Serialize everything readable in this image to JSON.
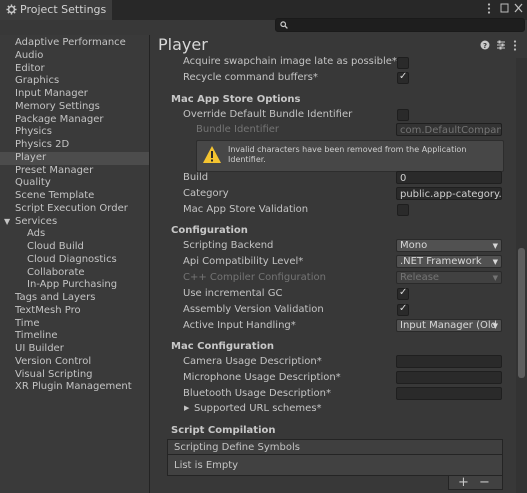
{
  "window": {
    "title": "Project Settings"
  },
  "search": {
    "placeholder": ""
  },
  "sidebar": {
    "items": [
      {
        "label": "Adaptive Performance"
      },
      {
        "label": "Audio"
      },
      {
        "label": "Editor"
      },
      {
        "label": "Graphics"
      },
      {
        "label": "Input Manager"
      },
      {
        "label": "Memory Settings"
      },
      {
        "label": "Package Manager"
      },
      {
        "label": "Physics"
      },
      {
        "label": "Physics 2D"
      },
      {
        "label": "Player",
        "selected": true
      },
      {
        "label": "Preset Manager"
      },
      {
        "label": "Quality"
      },
      {
        "label": "Scene Template"
      },
      {
        "label": "Script Execution Order"
      },
      {
        "label": "Services",
        "expanded": true
      },
      {
        "label": "Ads"
      },
      {
        "label": "Cloud Build"
      },
      {
        "label": "Cloud Diagnostics"
      },
      {
        "label": "Collaborate"
      },
      {
        "label": "In-App Purchasing"
      },
      {
        "label": "Tags and Layers"
      },
      {
        "label": "TextMesh Pro"
      },
      {
        "label": "Time"
      },
      {
        "label": "Timeline"
      },
      {
        "label": "UI Builder"
      },
      {
        "label": "Version Control"
      },
      {
        "label": "Visual Scripting"
      },
      {
        "label": "XR Plugin Management"
      }
    ]
  },
  "panel": {
    "title": "Player"
  },
  "settings": {
    "acquire_swapchain": {
      "label": "Acquire swapchain image late as possible*",
      "checked": false
    },
    "recycle_buffers": {
      "label": "Recycle command buffers*",
      "checked": true
    },
    "mac_app_store": {
      "header": "Mac App Store Options",
      "override_bundle": {
        "label": "Override Default Bundle Identifier",
        "checked": false
      },
      "bundle_identifier": {
        "label": "Bundle Identifier",
        "value": "com.DefaultCompany"
      },
      "warning": "Invalid characters have been removed from the Application Identifier.",
      "build": {
        "label": "Build",
        "value": "0"
      },
      "category": {
        "label": "Category",
        "value": "public.app-category.g"
      },
      "validation": {
        "label": "Mac App Store Validation",
        "checked": false
      }
    },
    "configuration": {
      "header": "Configuration",
      "scripting_backend": {
        "label": "Scripting Backend",
        "value": "Mono"
      },
      "api_compat": {
        "label": "Api Compatibility Level*",
        "value": ".NET Framework"
      },
      "cpp_compiler": {
        "label": "C++ Compiler Configuration",
        "value": "Release"
      },
      "incremental_gc": {
        "label": "Use incremental GC",
        "checked": true
      },
      "assembly_validation": {
        "label": "Assembly Version Validation",
        "checked": true
      },
      "input_handling": {
        "label": "Active Input Handling*",
        "value": "Input Manager (Old"
      }
    },
    "mac_configuration": {
      "header": "Mac Configuration",
      "camera_usage": {
        "label": "Camera Usage Description*",
        "value": ""
      },
      "microphone_usage": {
        "label": "Microphone Usage Description*",
        "value": ""
      },
      "bluetooth_usage": {
        "label": "Bluetooth Usage Description*",
        "value": ""
      },
      "url_schemes": {
        "label": "Supported URL schemes*"
      }
    },
    "script_compilation": {
      "header": "Script Compilation",
      "define_symbols": {
        "label": "Scripting Define Symbols",
        "empty_text": "List is Empty"
      },
      "add_button": "+",
      "remove_button": "−"
    }
  },
  "icons": {
    "window": "gear-icon",
    "help": "question-icon",
    "presets": "sliders-icon",
    "more": "kebab-menu-icon",
    "warning": "warning-triangle-icon"
  },
  "colors": {
    "background": "#383838",
    "sidebar": "#3a3a3a",
    "selected": "#4c4c4c",
    "warning": "#f4c430"
  }
}
